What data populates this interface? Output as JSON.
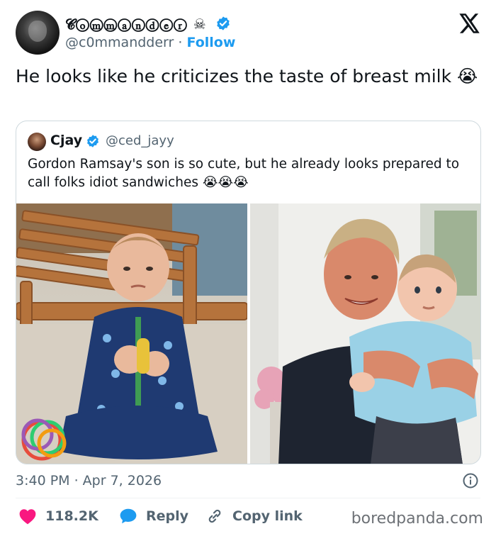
{
  "author": {
    "display_name": "𝓒ⓞⓜⓜⓐⓝⓓⓔⓡ ☠",
    "handle": "@c0mmandderr",
    "separator": "·",
    "follow_label": "Follow"
  },
  "tweet": {
    "text": "He looks like he criticizes the taste of breast milk 😭"
  },
  "quoted": {
    "name": "Cjay",
    "handle": "@ced_jayy",
    "text": "Gordon Ramsay's son is so cute, but he already looks prepared to call folks idiot sandwiches 😭😭😭"
  },
  "meta": {
    "timestamp": "3:40 PM · Apr 7, 2026"
  },
  "actions": {
    "like_count": "118.2K",
    "reply_label": "Reply",
    "copy_label": "Copy link"
  },
  "watermark": "boredpanda.com",
  "colors": {
    "accent": "#1d9bf0",
    "like": "#f91880",
    "text": "#0f1419",
    "muted": "#536471"
  },
  "icons": [
    "verified-badge-icon",
    "x-logo-icon",
    "info-icon",
    "heart-icon",
    "reply-bubble-icon",
    "link-icon"
  ]
}
